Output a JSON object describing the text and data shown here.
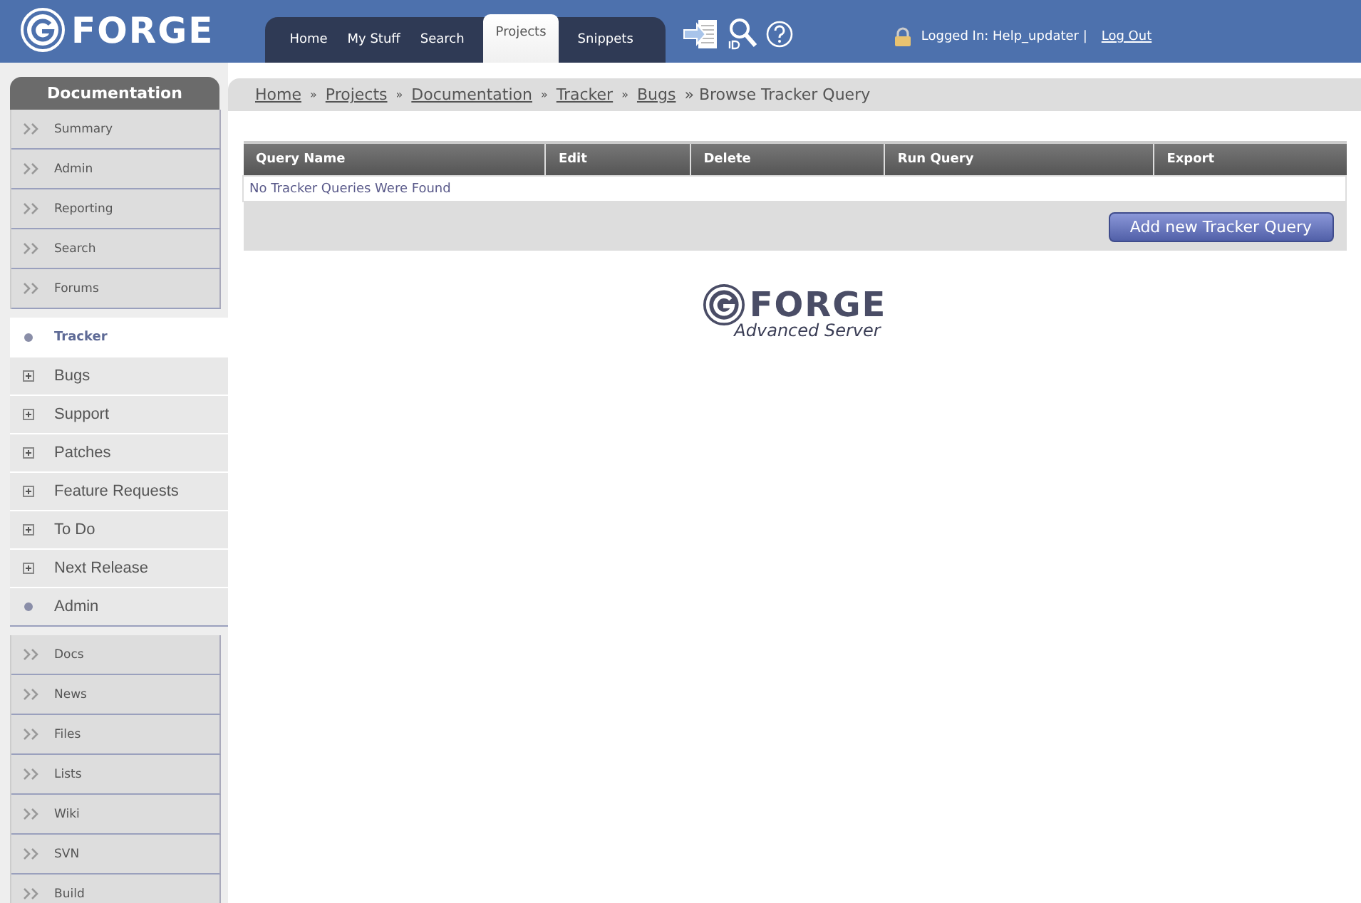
{
  "header": {
    "logo": "FORGE",
    "tabs": [
      {
        "label": "Home",
        "selected": false
      },
      {
        "label": "My Stuff",
        "selected": false
      },
      {
        "label": "Search",
        "selected": false
      },
      {
        "label": "Projects",
        "selected": true
      },
      {
        "label": "Snippets",
        "selected": false
      }
    ],
    "login_status": "Logged In: Help_updater |",
    "logout": "Log Out"
  },
  "sidebar": {
    "title": "Documentation",
    "menu": [
      "Summary",
      "Admin",
      "Reporting",
      "Search",
      "Forums"
    ],
    "tracker_items": [
      {
        "label": "Tracker",
        "kind": "bullet",
        "selected": true
      },
      {
        "label": "Bugs",
        "kind": "expand",
        "selected": false
      },
      {
        "label": "Support",
        "kind": "expand",
        "selected": false
      },
      {
        "label": "Patches",
        "kind": "expand",
        "selected": false
      },
      {
        "label": "Feature Requests",
        "kind": "expand",
        "selected": false
      },
      {
        "label": "To Do",
        "kind": "expand",
        "selected": false
      },
      {
        "label": "Next Release",
        "kind": "expand",
        "selected": false
      },
      {
        "label": "Admin",
        "kind": "bullet",
        "selected": false
      }
    ],
    "menu_more": [
      "Docs",
      "News",
      "Files",
      "Lists",
      "Wiki",
      "SVN",
      "Build"
    ]
  },
  "breadcrumb": [
    {
      "label": "Home",
      "kind": "link"
    },
    {
      "label": "»",
      "kind": "sep"
    },
    {
      "label": "Projects",
      "kind": "link"
    },
    {
      "label": "»",
      "kind": "sep"
    },
    {
      "label": "Documentation",
      "kind": "link"
    },
    {
      "label": "»",
      "kind": "sep"
    },
    {
      "label": "Tracker",
      "kind": "link"
    },
    {
      "label": "»",
      "kind": "sep"
    },
    {
      "label": "Bugs",
      "kind": "link"
    },
    {
      "label": "» Browse Tracker Query",
      "kind": "current"
    }
  ],
  "table": {
    "columns": [
      "Query Name",
      "Edit",
      "Delete",
      "Run Query",
      "Export"
    ],
    "empty_message": "No Tracker Queries Were Found",
    "add_button": "Add new Tracker Query"
  },
  "footer_logo": {
    "name": "FORGE",
    "subtitle": "Advanced Server"
  }
}
